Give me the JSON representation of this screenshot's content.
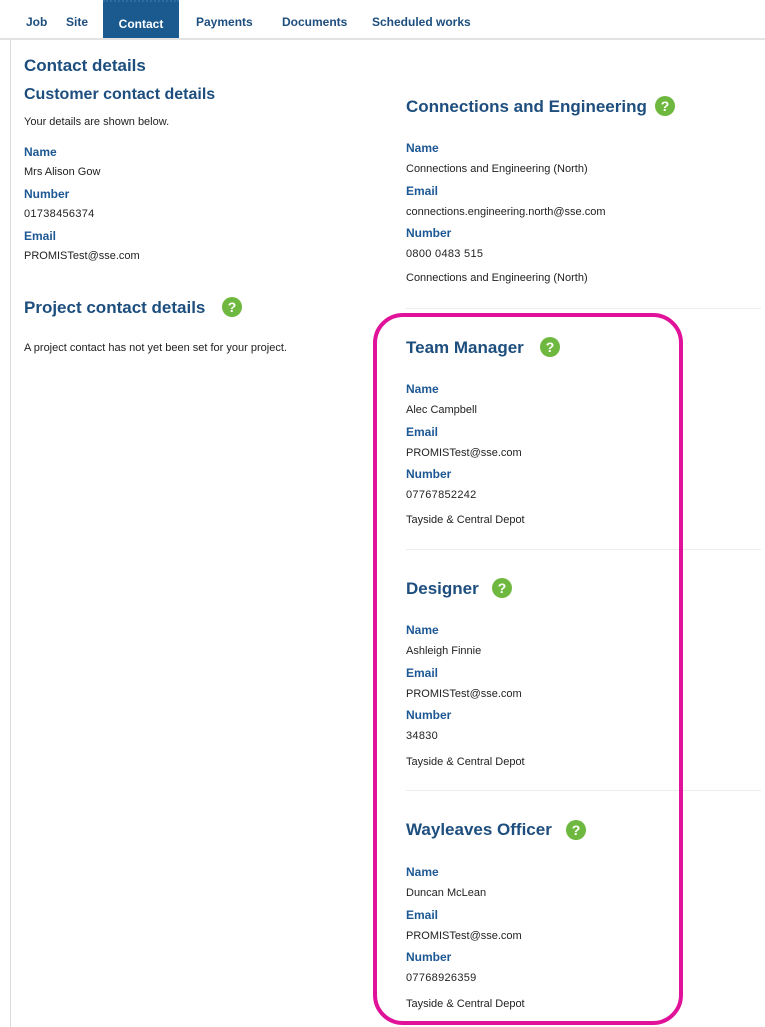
{
  "tabs": [
    {
      "label": "Job"
    },
    {
      "label": "Site"
    },
    {
      "label": "Contact"
    },
    {
      "label": "Payments"
    },
    {
      "label": "Documents"
    },
    {
      "label": "Scheduled works"
    }
  ],
  "active_tab": "Contact",
  "page_title": "Contact details",
  "customer": {
    "heading": "Customer contact details",
    "intro": "Your details are shown below.",
    "name_label": "Name",
    "name": "Mrs Alison Gow",
    "number_label": "Number",
    "number": "01738456374",
    "email_label": "Email",
    "email": "PROMISTest@sse.com"
  },
  "project": {
    "heading": "Project contact details",
    "message": "A project contact has not yet been set for your project."
  },
  "connections": {
    "heading": "Connections and Engineering",
    "name_label": "Name",
    "name": "Connections and Engineering (North)",
    "email_label": "Email",
    "email": "connections.engineering.north@sse.com",
    "number_label": "Number",
    "number": "0800 0483 515",
    "location": "Connections and Engineering (North)"
  },
  "team_manager": {
    "heading": "Team Manager",
    "name_label": "Name",
    "name": "Alec Campbell",
    "email_label": "Email",
    "email": "PROMISTest@sse.com",
    "number_label": "Number",
    "number": "07767852242",
    "depot": "Tayside & Central Depot"
  },
  "designer": {
    "heading": "Designer",
    "name_label": "Name",
    "name": "Ashleigh Finnie",
    "email_label": "Email",
    "email": "PROMISTest@sse.com",
    "number_label": "Number",
    "number": "34830",
    "depot": "Tayside & Central Depot"
  },
  "wayleaves": {
    "heading": "Wayleaves Officer",
    "name_label": "Name",
    "name": "Duncan McLean",
    "email_label": "Email",
    "email": "PROMISTest@sse.com",
    "number_label": "Number",
    "number": "07768926359",
    "depot": "Tayside & Central Depot"
  },
  "help_glyph": "?",
  "colors": {
    "accent": "#1d4e7e",
    "active_tab": "#1b5a8f",
    "help_icon": "#6fb83f",
    "highlight": "#e0129a"
  }
}
